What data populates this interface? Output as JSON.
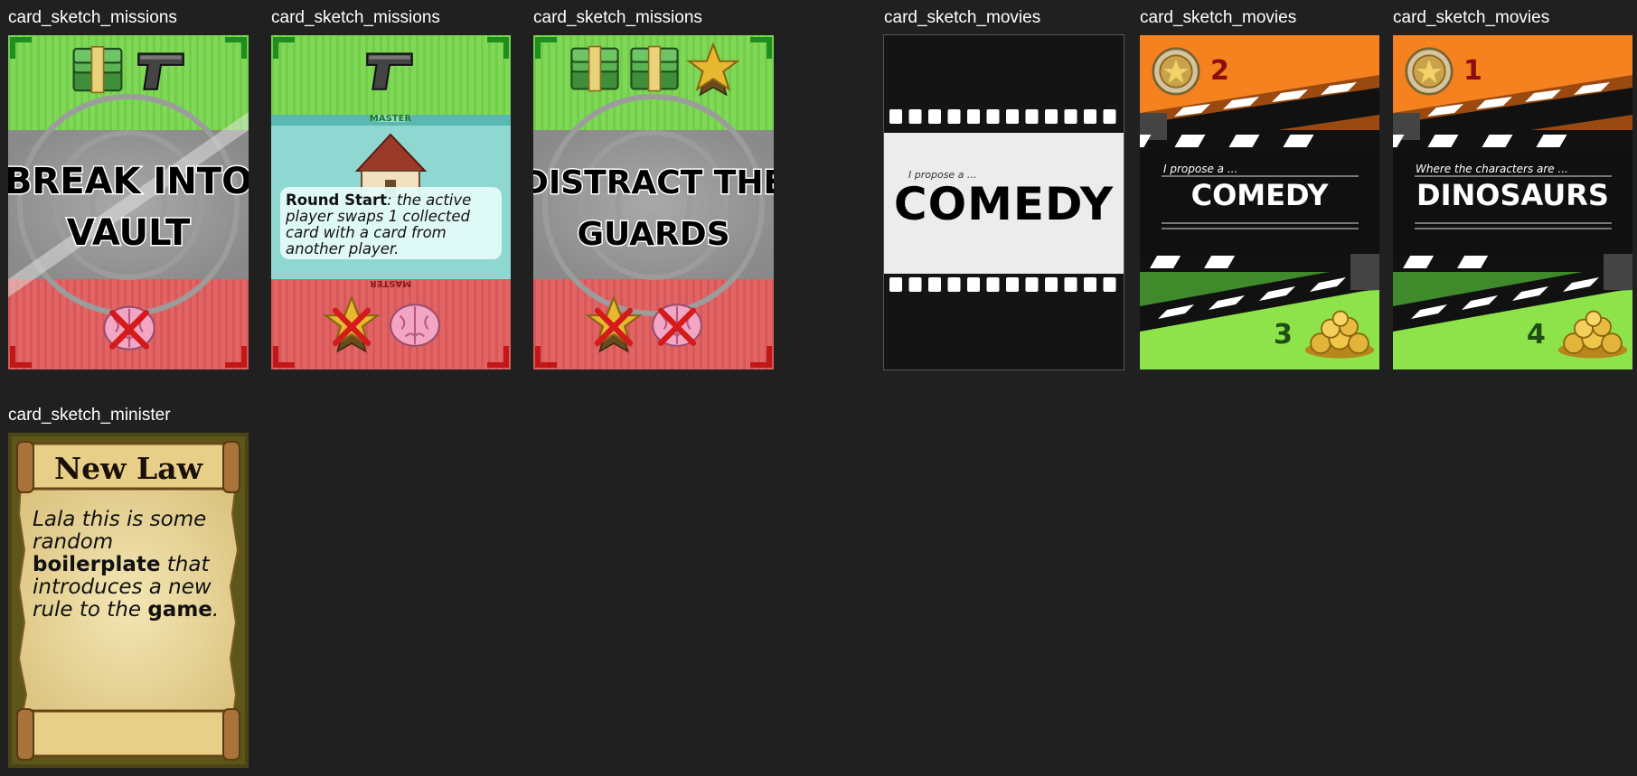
{
  "labels": {
    "missions1": "card_sketch_missions",
    "missions2": "card_sketch_missions",
    "missions3": "card_sketch_missions",
    "movies1": "card_sketch_movies",
    "movies2": "card_sketch_movies",
    "movies3": "card_sketch_movies",
    "minister": "card_sketch_minister"
  },
  "missions": [
    {
      "title_line1": "BREAK INTO",
      "title_line2": "VAULT",
      "rewards": [
        "cash-icon",
        "pistol-icon"
      ],
      "penalties": [
        "brain-icon"
      ]
    },
    {
      "banner_top": "MASTER",
      "banner_bottom": "MASTER",
      "ability_bold": "Round Start",
      "ability_text": ": the active player swaps 1 collected card with a card from another player.",
      "rewards": [
        "pistol-icon"
      ],
      "penalties": [
        "star-medal-icon",
        "brain-icon"
      ]
    },
    {
      "title_line1": "DISTRACT THE",
      "title_line2": "GUARDS",
      "rewards": [
        "cash-icon",
        "cash-icon",
        "star-medal-icon"
      ],
      "penalties": [
        "star-medal-icon",
        "brain-icon"
      ]
    }
  ],
  "movies": [
    {
      "prompt": "I propose a ...",
      "word": "COMEDY"
    },
    {
      "prompt": "I propose a ...",
      "word": "COMEDY",
      "top_number": "2",
      "bottom_number": "3"
    },
    {
      "prompt": "Where the characters are ...",
      "word": "DINOSAURS",
      "top_number": "1",
      "bottom_number": "4"
    }
  ],
  "minister": {
    "title": "New Law",
    "text_parts": [
      "Lala this is some random ",
      "boilerplate",
      " that introduces a new rule to the ",
      "game",
      "."
    ]
  },
  "colors": {
    "background": "#202020",
    "mission_green": "#7ed957",
    "mission_red": "#e06060",
    "mission_grey": "#9a9a9a",
    "movie_orange": "#f5821f",
    "movie_green": "#8ee34a",
    "parchment": "#ecd9a0"
  }
}
